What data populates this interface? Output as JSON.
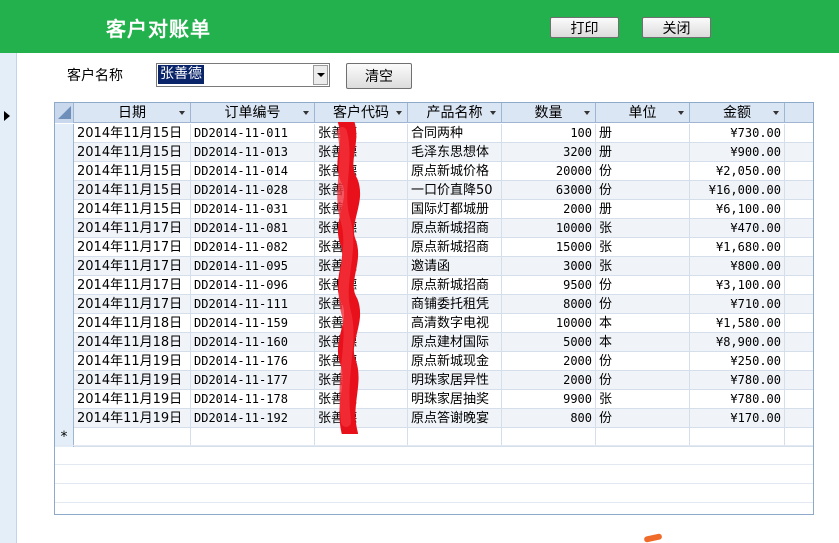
{
  "header": {
    "title": "客户对账单",
    "print_label": "打印",
    "close_label": "关闭",
    "color": "#22b14c"
  },
  "filter": {
    "customer_label": "客户名称",
    "customer_value": "张善德",
    "clear_label": "清空"
  },
  "grid": {
    "columns": [
      "日期",
      "订单编号",
      "客户代码",
      "产品名称",
      "数量",
      "单位",
      "金额"
    ],
    "new_row_marker": "*",
    "rows": [
      [
        "2014年11月15日",
        "DD2014-11-011",
        "张善德",
        "合同两种",
        "100",
        "册",
        "¥730.00"
      ],
      [
        "2014年11月15日",
        "DD2014-11-013",
        "张善德",
        "毛泽东思想体",
        "3200",
        "册",
        "¥900.00"
      ],
      [
        "2014年11月15日",
        "DD2014-11-014",
        "张善德",
        "原点新城价格",
        "20000",
        "份",
        "¥2,050.00"
      ],
      [
        "2014年11月15日",
        "DD2014-11-028",
        "张善德",
        "一口价直降50",
        "63000",
        "份",
        "¥16,000.00"
      ],
      [
        "2014年11月15日",
        "DD2014-11-031",
        "张善德",
        "国际灯都城册",
        "2000",
        "册",
        "¥6,100.00"
      ],
      [
        "2014年11月17日",
        "DD2014-11-081",
        "张善德",
        "原点新城招商",
        "10000",
        "张",
        "¥470.00"
      ],
      [
        "2014年11月17日",
        "DD2014-11-082",
        "张善德",
        "原点新城招商",
        "15000",
        "张",
        "¥1,680.00"
      ],
      [
        "2014年11月17日",
        "DD2014-11-095",
        "张善德",
        "邀请函",
        "3000",
        "张",
        "¥800.00"
      ],
      [
        "2014年11月17日",
        "DD2014-11-096",
        "张善德",
        "原点新城招商",
        "9500",
        "份",
        "¥3,100.00"
      ],
      [
        "2014年11月17日",
        "DD2014-11-111",
        "张善德",
        "商铺委托租凭",
        "8000",
        "份",
        "¥710.00"
      ],
      [
        "2014年11月18日",
        "DD2014-11-159",
        "张善德",
        "高清数字电视",
        "10000",
        "本",
        "¥1,580.00"
      ],
      [
        "2014年11月18日",
        "DD2014-11-160",
        "张善德",
        "原点建材国际",
        "5000",
        "本",
        "¥8,900.00"
      ],
      [
        "2014年11月19日",
        "DD2014-11-176",
        "张善德",
        "原点新城现金",
        "2000",
        "份",
        "¥250.00"
      ],
      [
        "2014年11月19日",
        "DD2014-11-177",
        "张善德",
        "明珠家居异性",
        "2000",
        "份",
        "¥780.00"
      ],
      [
        "2014年11月19日",
        "DD2014-11-178",
        "张善德",
        "明珠家居抽奖",
        "9900",
        "张",
        "¥780.00"
      ],
      [
        "2014年11月19日",
        "DD2014-11-192",
        "张善德",
        "原点答谢晚宴",
        "800",
        "份",
        "¥170.00"
      ]
    ]
  }
}
